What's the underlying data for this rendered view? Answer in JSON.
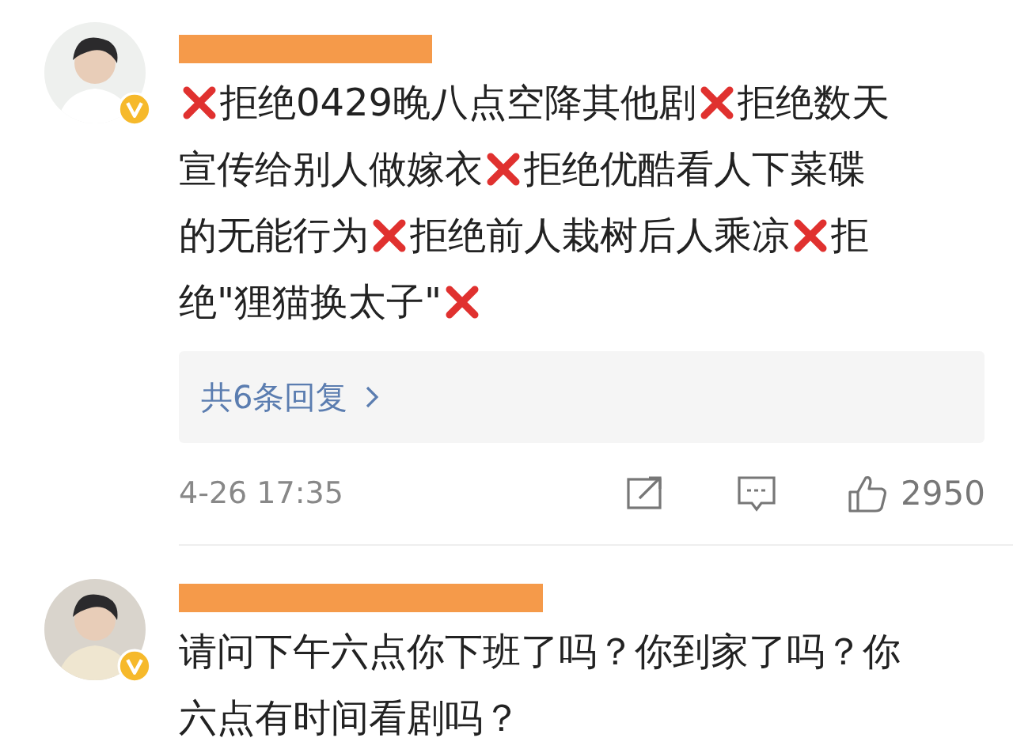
{
  "comments": [
    {
      "verified": true,
      "lines": [
        [
          {
            "kind": "cross"
          },
          {
            "kind": "text",
            "text": "拒绝0429晚八点空降其他剧"
          },
          {
            "kind": "cross"
          },
          {
            "kind": "text",
            "text": "拒绝数天"
          }
        ],
        [
          {
            "kind": "text",
            "text": "宣传给别人做嫁衣"
          },
          {
            "kind": "cross"
          },
          {
            "kind": "text",
            "text": "拒绝优酷看人下菜碟"
          }
        ],
        [
          {
            "kind": "text",
            "text": "的无能行为"
          },
          {
            "kind": "cross"
          },
          {
            "kind": "text",
            "text": "拒绝前人栽树后人乘凉"
          },
          {
            "kind": "cross"
          },
          {
            "kind": "text",
            "text": "拒"
          }
        ],
        [
          {
            "kind": "text",
            "text": "绝\"狸猫换太子\""
          },
          {
            "kind": "cross"
          }
        ]
      ],
      "replies": "共6条回复",
      "time": "4-26 17:35",
      "likes": "2950"
    },
    {
      "verified": true,
      "lines": [
        [
          {
            "kind": "text",
            "text": "请问下午六点你下班了吗？你到家了吗？你"
          }
        ],
        [
          {
            "kind": "text",
            "text": "六点有时间看剧吗？"
          }
        ]
      ]
    }
  ]
}
